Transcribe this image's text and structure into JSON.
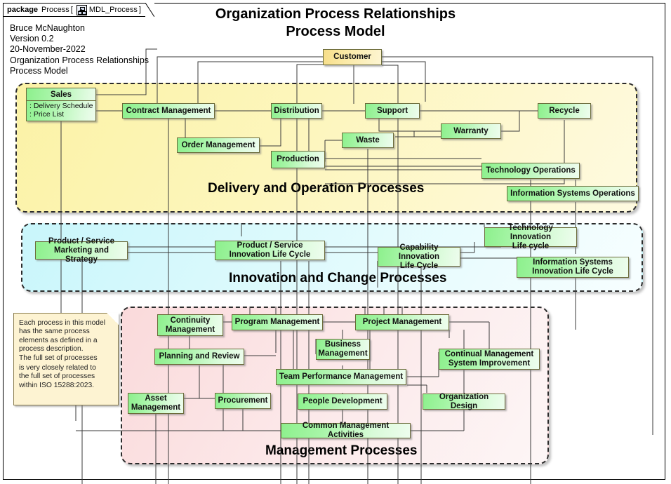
{
  "package": {
    "keyword": "package",
    "name": "Process",
    "bracket_open": "[",
    "icon": "diagram-icon",
    "diagram_name": "MDL_Process",
    "bracket_close": "]"
  },
  "meta": {
    "line1": "Bruce McNaughton",
    "line2": "Version 0.2",
    "line3": "20-November-2022",
    "line4": "Organization Process Relationships",
    "line5": "Process Model"
  },
  "title": {
    "line1": "Organization Process Relationships",
    "line2": "Process Model"
  },
  "regions": [
    {
      "id": "delivery",
      "label": "Delivery and Operation Processes",
      "color": "#faf0a0"
    },
    {
      "id": "innovation",
      "label": "Innovation and Change Processes",
      "color": "#d7f8fc"
    },
    {
      "id": "management",
      "label": "Management Processes",
      "color": "#fbdede"
    }
  ],
  "nodes": {
    "customer": "Customer",
    "sales_title": "Sales",
    "sales_attr1": ": Delivery Schedule",
    "sales_attr2": ": Price List",
    "contract_management": "Contract Management",
    "distribution": "Distribution",
    "support": "Support",
    "recycle": "Recycle",
    "order_management": "Order Management",
    "waste": "Waste",
    "warranty": "Warranty",
    "production": "Production",
    "technology_operations": "Technology Operations",
    "information_systems_operations": "Information Systems Operations",
    "ps_marketing_l1": "Product / Service",
    "ps_marketing_l2": "Marketing and Strategy",
    "ps_innovation_l1": "Product / Service",
    "ps_innovation_l2": "Innovation Life Cycle",
    "capability_innovation_l1": "Capability Innovation",
    "capability_innovation_l2": "Life Cycle",
    "technology_innovation_l1": "Technology Innovation",
    "technology_innovation_l2": "Life cycle",
    "is_innovation_l1": "Information Systems",
    "is_innovation_l2": "Innovation Life Cycle",
    "continuity_management_l1": "Continuity",
    "continuity_management_l2": "Management",
    "program_management": "Program Management",
    "project_management": "Project Management",
    "planning_and_review": "Planning and Review",
    "business_management_l1": "Business",
    "business_management_l2": "Management",
    "continual_improvement_l1": "Continual Management",
    "continual_improvement_l2": "System Improvement",
    "team_performance_management": "Team Performance Management",
    "asset_management_l1": "Asset",
    "asset_management_l2": "Management",
    "procurement": "Procurement",
    "people_development": "People Development",
    "organization_design": "Organization Design",
    "common_management_activities": "Common Management Activities"
  },
  "note": {
    "line1": "Each process in this model",
    "line2": "has the same process",
    "line3": "elements as defined in a",
    "line4": "process description.",
    "line5": "The full set of processes",
    "line6": "is very closely related to",
    "line7": "the full set of processes",
    "line8": "within ISO 15288:2023."
  }
}
